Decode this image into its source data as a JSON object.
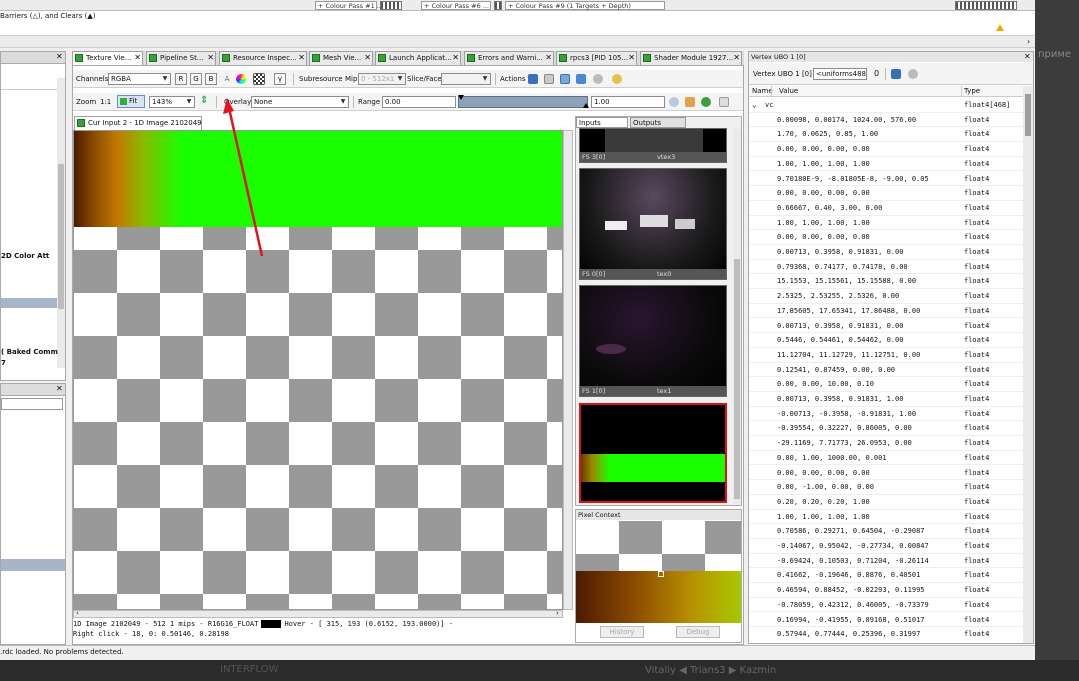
{
  "top": {
    "passes": [
      "+ Colour Pass #1 ...",
      "+ Colour Pass #6 ...",
      "+ Colour Pass #9 (1 Targets + Depth)"
    ],
    "barriers_text": "Barriers (△), and Clears (▲)"
  },
  "tabs": [
    {
      "label": "Texture Vie...",
      "close": "✕"
    },
    {
      "label": "Pipeline St...",
      "close": "✕"
    },
    {
      "label": "Resource Inspec...",
      "close": "✕"
    },
    {
      "label": "Mesh Vie...",
      "close": "✕"
    },
    {
      "label": "Launch Applicat...",
      "close": "✕"
    },
    {
      "label": "Errors and Warni...",
      "close": "✕"
    },
    {
      "label": "rpcs3 [PID 105...",
      "close": "✕"
    },
    {
      "label": "Shader Module 1927...",
      "close": "✕"
    }
  ],
  "toolbar": {
    "channels_label": "Channels",
    "channels_value": "RGBA",
    "r": "R",
    "g": "G",
    "b": "B",
    "a": "A",
    "gamma": "γ",
    "subresource_label": "Subresource",
    "mip_label": "Mip",
    "mip_value": "0 - 512x1",
    "slice_label": "Slice/Face",
    "actions_label": "Actions",
    "zoom_label": "Zoom",
    "zoom_one": "1:1",
    "fit_label": "Fit",
    "zoom_value": "143%",
    "overlay_label": "Overlay",
    "overlay_value": "None",
    "range_label": "Range",
    "range_min": "0.00",
    "range_max": "1.00"
  },
  "texture": {
    "tab_label": "Cur Input 2 - 1D Image 2102049",
    "status_line1": "1D Image 2102049 - 512 1 mips - R16G16_FLOAT",
    "status_hover": "Hover - [ 315,  193 (0.6152, 193.0000)] -",
    "status_line2": "Right click -   18,     0: 0.50146, 0.28198"
  },
  "thumbs": {
    "inputs_tab": "Inputs",
    "outputs_tab": "Outputs",
    "items": [
      {
        "slot": "FS 3[0]",
        "name": "vtex3"
      },
      {
        "slot": "FS 0[0]",
        "name": "tex0"
      },
      {
        "slot": "FS 1[0]",
        "name": "tex1"
      }
    ]
  },
  "pixel_context": {
    "title": "Pixel Context",
    "history": "History",
    "debug": "Debug"
  },
  "vertex_ubo": {
    "title": "Vertex UBO 1 [0]",
    "sub_label": "Vertex UBO 1 [0]",
    "uniforms_value": "<uniforms488>",
    "index_value": "0",
    "col_name": "Name",
    "col_value": "Value",
    "col_type": "Type",
    "root_name": "vc",
    "root_type": "float4[468]",
    "rows": [
      {
        "v": "0.00098, 0.00174, 1024.00, 576.00",
        "t": "float4"
      },
      {
        "v": "1.70, 0.0625, 0.85, 1.00",
        "t": "float4"
      },
      {
        "v": "0.00, 0.00, 0.00, 0.00",
        "t": "float4"
      },
      {
        "v": "1.00, 1.00, 1.00, 1.00",
        "t": "float4"
      },
      {
        "v": "9.70180E-9, -8.01805E-8, -9.00, 0.05",
        "t": "float4"
      },
      {
        "v": "0.00, 0.00, 0.00, 0.00",
        "t": "float4"
      },
      {
        "v": "0.66667, 0.40, 3.00, 0.00",
        "t": "float4"
      },
      {
        "v": "1.00, 1.00, 1.00, 1.00",
        "t": "float4"
      },
      {
        "v": "0.00, 0.00, 0.00, 0.00",
        "t": "float4"
      },
      {
        "v": "0.00713, 0.3958, 0.91831, 0.00",
        "t": "float4"
      },
      {
        "v": "0.79368, 0.74177, 0.74178, 0.00",
        "t": "float4"
      },
      {
        "v": "15.1553, 15.15561, 15.15588, 0.00",
        "t": "float4"
      },
      {
        "v": "2.5325, 2.53255, 2.5326, 0.00",
        "t": "float4"
      },
      {
        "v": "17.85605, 17.65341, 17.86488, 0.00",
        "t": "float4"
      },
      {
        "v": "0.00713, 0.3958, 0.91831, 0.00",
        "t": "float4"
      },
      {
        "v": "0.5446, 0.54461, 0.54462, 0.00",
        "t": "float4"
      },
      {
        "v": "11.12704, 11.12729, 11.12751, 0.00",
        "t": "float4"
      },
      {
        "v": "0.12541, 0.87459, 0.00, 0.00",
        "t": "float4"
      },
      {
        "v": "0.00, 0.00, 10.00, 0.10",
        "t": "float4"
      },
      {
        "v": "0.00713, 0.3958, 0.91831, 1.00",
        "t": "float4"
      },
      {
        "v": "-0.00713, -0.3958, -0.91831, 1.00",
        "t": "float4"
      },
      {
        "v": "-0.39554, 0.32227, 0.86005, 0.00",
        "t": "float4"
      },
      {
        "v": "-29.1169, 7.71773, 26.0953, 0.00",
        "t": "float4"
      },
      {
        "v": "0.00, 1.00, 1000.00, 0.001",
        "t": "float4"
      },
      {
        "v": "0.00, 0.00, 0.00, 0.00",
        "t": "float4"
      },
      {
        "v": "0.00, -1.00, 0.00, 0.00",
        "t": "float4"
      },
      {
        "v": "0.20, 0.20, 0.20, 1.00",
        "t": "float4"
      },
      {
        "v": "1.00, 1.00, 1.00, 1.00",
        "t": "float4"
      },
      {
        "v": "0.70586, 0.29271, 0.64504, -0.29087",
        "t": "float4"
      },
      {
        "v": "-0.14067, 0.95042, -0.27734, 0.00847",
        "t": "float4"
      },
      {
        "v": "-0.69424, 0.10503, 0.71204, -0.26114",
        "t": "float4"
      },
      {
        "v": "0.41662, -0.19646, 0.8876, 0.40501",
        "t": "float4"
      },
      {
        "v": "0.46594, 0.88452, -0.02293, 0.11995",
        "t": "float4"
      },
      {
        "v": "-0.78059, 0.42312, 0.46005, -0.73379",
        "t": "float4"
      },
      {
        "v": "0.16994, -0.41955, 0.89168, 0.51017",
        "t": "float4"
      },
      {
        "v": "0.57944, 0.77444, 0.25396, 0.31997",
        "t": "float4"
      }
    ]
  },
  "left_panel": {
    "item1": "2D Color Att",
    "item2": "( Baked Comm",
    "item3": "7"
  },
  "status_bar": ".rdc loaded. No problems detected.",
  "background": {
    "right_text": "приме",
    "bottom_text1": "INTERFLOW",
    "bottom_text2": "Vitaliy ◀ Trians3 ▶ Kazmin"
  },
  "colors": {
    "accent_green": "#2fae3a",
    "arrow_red": "#e0151b",
    "bright_green": "#19ff00"
  }
}
